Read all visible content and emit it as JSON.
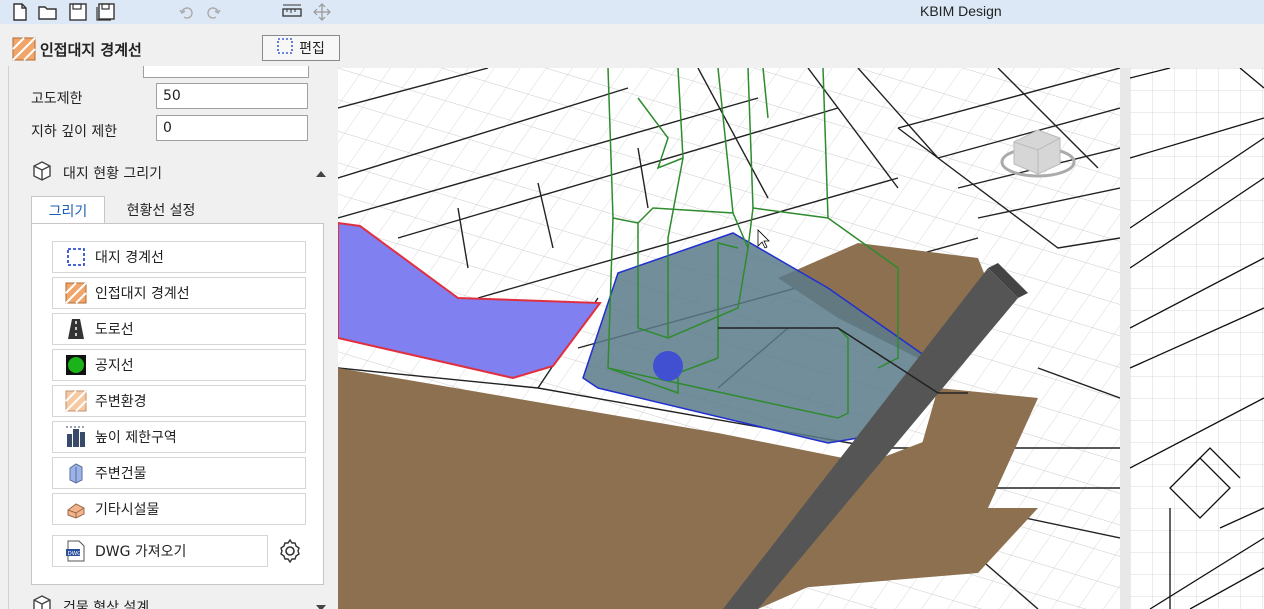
{
  "app_title": "KBIM Design",
  "header": {
    "title": "인접대지 경계선",
    "edit_label": "편집"
  },
  "fields": [
    {
      "label": "고도제한",
      "value": "50"
    },
    {
      "label": "지하 깊이 제한",
      "value": "0"
    }
  ],
  "section_site": {
    "label": "대지 현황 그리기"
  },
  "tabs": [
    {
      "label": "그리기"
    },
    {
      "label": "현황선 설정"
    }
  ],
  "tools": [
    {
      "label": "대지 경계선",
      "icon": "site-boundary-icon"
    },
    {
      "label": "인접대지 경계선",
      "icon": "adjacent-boundary-icon"
    },
    {
      "label": "도로선",
      "icon": "road-icon"
    },
    {
      "label": "공지선",
      "icon": "open-space-icon"
    },
    {
      "label": "주변환경",
      "icon": "environment-icon"
    },
    {
      "label": "높이 제한구역",
      "icon": "height-limit-icon"
    },
    {
      "label": "주변건물",
      "icon": "building-icon"
    },
    {
      "label": "기타시설물",
      "icon": "facility-icon"
    }
  ],
  "dwg_import": {
    "label": "DWG 가져오기"
  },
  "section_building": {
    "label": "건물 형상 설계"
  },
  "colors": {
    "site": "#5b7a8a",
    "adjacent": "#8c7050",
    "neighbor_blue": "#8080f0",
    "boundary_red": "#e03040",
    "road": "#555555",
    "mass_green": "#2e8b2e"
  }
}
